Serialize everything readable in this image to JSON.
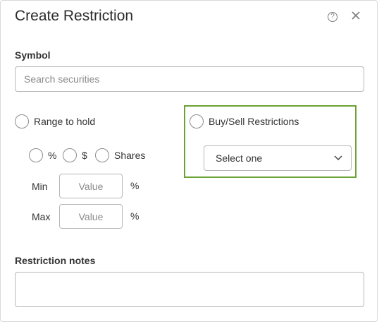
{
  "dialog": {
    "title": "Create Restriction",
    "help_icon": "question-circle-icon",
    "help_glyph": "?",
    "close_icon": "close-icon"
  },
  "symbol": {
    "label": "Symbol",
    "placeholder": "Search securities",
    "value": ""
  },
  "range_to_hold": {
    "label": "Range to hold",
    "selected": false,
    "unit_options": [
      {
        "label": "%",
        "selected": false
      },
      {
        "label": "$",
        "selected": false
      },
      {
        "label": "Shares",
        "selected": false
      }
    ],
    "min": {
      "label": "Min",
      "placeholder": "Value",
      "value": "",
      "unit": "%"
    },
    "max": {
      "label": "Max",
      "placeholder": "Value",
      "value": "",
      "unit": "%"
    }
  },
  "buy_sell": {
    "label": "Buy/Sell Restrictions",
    "selected": false,
    "select_value": "Select one",
    "highlight_color": "#6ba233"
  },
  "notes": {
    "label": "Restriction notes",
    "value": ""
  }
}
